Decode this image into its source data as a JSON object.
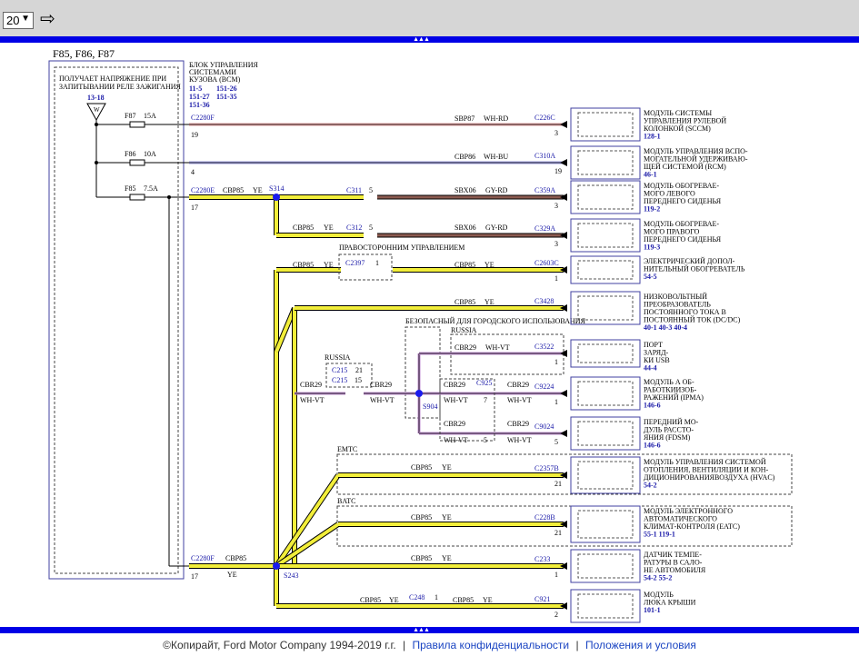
{
  "toolbar": {
    "page_value": "20",
    "go_icon": "arrow-right-icon"
  },
  "diagram": {
    "fuse_box_title": "F85, F86, F87",
    "ignition_note": [
      "ПОЛУЧАЕТ НАПРЯЖЕНИЕ ПРИ",
      "ЗАПИТЫВАНИИ РЕЛЕ ЗАЖИГАНИЯ"
    ],
    "ignition_ref": "13-18",
    "ignition_symbol": "W",
    "bcm_title": [
      "БЛОК УПРАВЛЕНИЯ",
      "СИСТЕМАМИ",
      "КУЗОВА (BCM)"
    ],
    "bcm_refs": [
      "11-5",
      "151-26",
      "151-27",
      "151-35",
      "151-36"
    ],
    "fuses": [
      {
        "id": "F87",
        "amp": "15A"
      },
      {
        "id": "F86",
        "amp": "10A"
      },
      {
        "id": "F85",
        "amp": "7.5A"
      }
    ],
    "connectors": {
      "c2280f_top": "C2280F",
      "c2280f_top_pin": "19",
      "c2280f_2_pin": "4",
      "c2280e": "C2280E",
      "c2280e_pin": "17",
      "c2280f_bottom": "C2280F",
      "c2280f_bottom_pin": "17",
      "s314": "S314",
      "s243": "S243",
      "s904": "S904",
      "c311": "C311",
      "c311_pin": "5",
      "c312": "C312",
      "c312_pin": "5",
      "c2397": "C2397",
      "c2397_pin": "1",
      "c215_a": "C215",
      "c215_a_pin": "21",
      "c215_b": "C215",
      "c215_b_pin": "15",
      "c925": "C925",
      "c925_pin": "7",
      "c925_pin2": "5",
      "c248": "C248",
      "c248_pin": "1"
    },
    "wires": {
      "sbp87": "SBP87",
      "sbp87_color": "WH-RD",
      "cbp86": "CBP86",
      "cbp86_color": "WH-BU",
      "cbp85": "CBP85",
      "ye": "YE",
      "sbx06": "SBX06",
      "gy_rd": "GY-RD",
      "cbr29": "CBR29",
      "wh_vt": "WH-VT"
    },
    "notes": {
      "right_hand_drive": "ПРАВОСТОРОННИМ УПРАВЛЕНИЕМ",
      "taxi": "БЕЗОПАСНЫЙ ДЛЯ ГОРОДСКОГО ИСПОЛЬЗОВАНИЯ",
      "russia_1": "RUSSIA",
      "russia_2": "RUSSIA",
      "emtc": "EMTC",
      "batc": "BATC"
    },
    "modules": [
      {
        "connector": "C226C",
        "pin": "3",
        "name": [
          "МОДУЛЬ СИСТЕМЫ",
          "УПРАВЛЕНИЯ РУЛЕВОЙ",
          "КОЛОНКОЙ (SCCM)"
        ],
        "refs": "128-1"
      },
      {
        "connector": "C310A",
        "pin": "19",
        "name": [
          "МОДУЛЬ УПРАВЛЕНИЯ ВСПО-",
          "МОГАТЕЛЬНОЙ УДЕРЖИВАЮ-",
          "ЩЕЙ СИСТЕМОЙ (RCM)"
        ],
        "refs": "46-1"
      },
      {
        "connector": "C359A",
        "pin": "3",
        "name": [
          "МОДУЛЬ ОБОГРЕВАЕ-",
          "МОГО ЛЕВОГО",
          "ПЕРЕДНЕГО СИДЕНЬЯ"
        ],
        "refs": "119-2"
      },
      {
        "connector": "C329A",
        "pin": "3",
        "name": [
          "МОДУЛЬ ОБОГРЕВАЕ-",
          "МОГО ПРАВОГО",
          "ПЕРЕДНЕГО СИДЕНЬЯ"
        ],
        "refs": "119-3"
      },
      {
        "connector": "C2603C",
        "pin": "1",
        "name": [
          "ЭЛЕКТРИЧЕСКИЙ ДОПОЛ-",
          "НИТЕЛЬНЫЙ ОБОГРЕВАТЕЛЬ"
        ],
        "refs": "54-5"
      },
      {
        "connector": "C3428",
        "pin": "",
        "name": [
          "НИЗКОВОЛЬТНЫЙ",
          "ПРЕОБРАЗОВАТЕЛЬ",
          "ПОСТОЯННОГО ТОКА В",
          "ПОСТОЯННЫЙ ТОК (DC/DC)"
        ],
        "refs": "40-1   40-3   40-4"
      },
      {
        "connector": "C3522",
        "pin": "1",
        "name": [
          "ПОРТ",
          "ЗАРЯД-",
          "КИ USB"
        ],
        "refs": "44-4"
      },
      {
        "connector": "C9224",
        "pin": "1",
        "name": [
          "МОДУЛЬ А ОБ-",
          "РАБОТКИИЗОБ-",
          "РАЖЕНИЙ (IPMA)"
        ],
        "refs": "146-6"
      },
      {
        "connector": "C9024",
        "pin": "5",
        "name": [
          "ПЕРЕДНИЙ МО-",
          "ДУЛЬ РАССТО-",
          "ЯНИЯ (FDSM)"
        ],
        "refs": "146-6"
      },
      {
        "connector": "C2357B",
        "pin": "21",
        "name": [
          "МОДУЛЬ УПРАВЛЕНИЯ СИСТЕМОЙ",
          "ОТОПЛЕНИЯ, ВЕНТИЛЯЦИИ И КОН-",
          "ДИЦИОНИРОВАНИЯВОЗДУХА (HVAC)"
        ],
        "refs": "54-2"
      },
      {
        "connector": "C228B",
        "pin": "21",
        "name": [
          "МОДУЛЬ ЭЛЕКТРОННОГО",
          "АВТОМАТИЧЕСКОГО",
          "КЛИМАТ-КОНТРОЛЯ (EATC)"
        ],
        "refs": "55-1   119-1"
      },
      {
        "connector": "C233",
        "pin": "1",
        "name": [
          "ДАТЧИК ТЕМПЕ-",
          "РАТУРЫ В САЛО-",
          "НЕ АВТОМОБИЛЯ"
        ],
        "refs": "54-2   55-2"
      },
      {
        "connector": "C921",
        "pin": "2",
        "name": [
          "МОДУЛЬ",
          "ЛЮКА КРЫШИ"
        ],
        "refs": "101-1"
      }
    ]
  },
  "footer": {
    "copyright": "©Копирайт, Ford Motor Company 1994-2019 г.г.",
    "sep": "|",
    "privacy": "Правила конфиденциальности",
    "terms": "Положения и условия"
  },
  "colors": {
    "bar": "#0000e6",
    "wire_yellow": "#f2ee3a",
    "wire_brown": "#8b5a50",
    "ref_blue": "#1a1aa8"
  }
}
